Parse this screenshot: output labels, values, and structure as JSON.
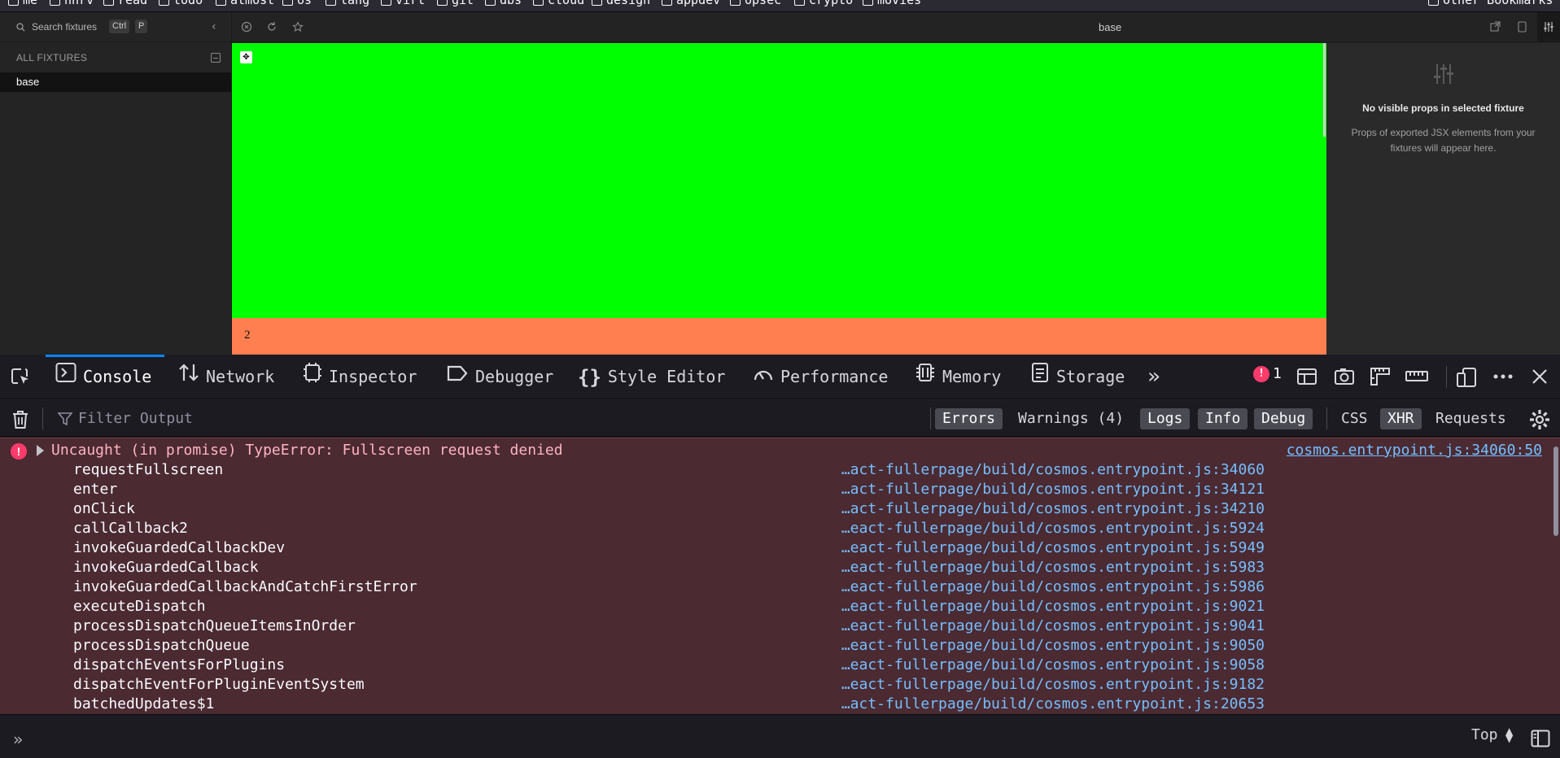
{
  "bookmarks": [
    "me",
    "hnrv",
    "read",
    "todo",
    "atmost",
    "os",
    "lang",
    "virt",
    "git",
    "dbs",
    "cloud",
    "design",
    "appdev",
    "opsec",
    "crypto",
    "movies"
  ],
  "other_bookmarks": "Other Bookmarks",
  "cosmos": {
    "search_placeholder": "Search fixtures",
    "kbd_ctrl": "Ctrl",
    "kbd_p": "P",
    "fixtures_heading": "ALL FIXTURES",
    "fixtures": [
      "base"
    ],
    "selected_fixture": "base",
    "preview_footer_text": "2",
    "props_title": "No visible props in selected fixture",
    "props_desc": "Props of exported JSX elements from your fixtures will appear here."
  },
  "devtools": {
    "tabs": [
      {
        "label": "Console",
        "icon": "console-icon"
      },
      {
        "label": "Network",
        "icon": "network-icon"
      },
      {
        "label": "Inspector",
        "icon": "inspector-icon"
      },
      {
        "label": "Debugger",
        "icon": "debugger-icon"
      },
      {
        "label": "Style Editor",
        "icon": "style-editor-icon"
      },
      {
        "label": "Performance",
        "icon": "performance-icon"
      },
      {
        "label": "Memory",
        "icon": "memory-icon"
      },
      {
        "label": "Storage",
        "icon": "storage-icon"
      }
    ],
    "active_tab": "Console",
    "error_count": "1",
    "filter_placeholder": "Filter Output",
    "filters": {
      "errors": "Errors",
      "warnings": "Warnings (4)",
      "logs": "Logs",
      "info": "Info",
      "debug": "Debug",
      "css": "CSS",
      "xhr": "XHR",
      "requests": "Requests"
    },
    "error": {
      "message": "Uncaught (in promise) TypeError: Fullscreen request denied",
      "source": "cosmos.entrypoint.js:34060:50",
      "stack": [
        {
          "fn": "requestFullscreen",
          "loc": "…act-fullerpage/build/cosmos.entrypoint.js:34060"
        },
        {
          "fn": "enter",
          "loc": "…act-fullerpage/build/cosmos.entrypoint.js:34121"
        },
        {
          "fn": "onClick",
          "loc": "…act-fullerpage/build/cosmos.entrypoint.js:34210"
        },
        {
          "fn": "callCallback2",
          "loc": "…eact-fullerpage/build/cosmos.entrypoint.js:5924"
        },
        {
          "fn": "invokeGuardedCallbackDev",
          "loc": "…eact-fullerpage/build/cosmos.entrypoint.js:5949"
        },
        {
          "fn": "invokeGuardedCallback",
          "loc": "…eact-fullerpage/build/cosmos.entrypoint.js:5983"
        },
        {
          "fn": "invokeGuardedCallbackAndCatchFirstError",
          "loc": "…eact-fullerpage/build/cosmos.entrypoint.js:5986"
        },
        {
          "fn": "executeDispatch",
          "loc": "…eact-fullerpage/build/cosmos.entrypoint.js:9021"
        },
        {
          "fn": "processDispatchQueueItemsInOrder",
          "loc": "…eact-fullerpage/build/cosmos.entrypoint.js:9041"
        },
        {
          "fn": "processDispatchQueue",
          "loc": "…eact-fullerpage/build/cosmos.entrypoint.js:9050"
        },
        {
          "fn": "dispatchEventsForPlugins",
          "loc": "…eact-fullerpage/build/cosmos.entrypoint.js:9058"
        },
        {
          "fn": "dispatchEventForPluginEventSystem",
          "loc": "…eact-fullerpage/build/cosmos.entrypoint.js:9182"
        },
        {
          "fn": "batchedUpdates$1",
          "loc": "…act-fullerpage/build/cosmos.entrypoint.js:20653"
        }
      ]
    },
    "context_selector": "Top"
  },
  "colors": {
    "preview_bg": "#00ff00",
    "preview_footer_bg": "#ff7f50",
    "error_row_bg": "#4b2a32",
    "accent": "#0a84ff"
  }
}
